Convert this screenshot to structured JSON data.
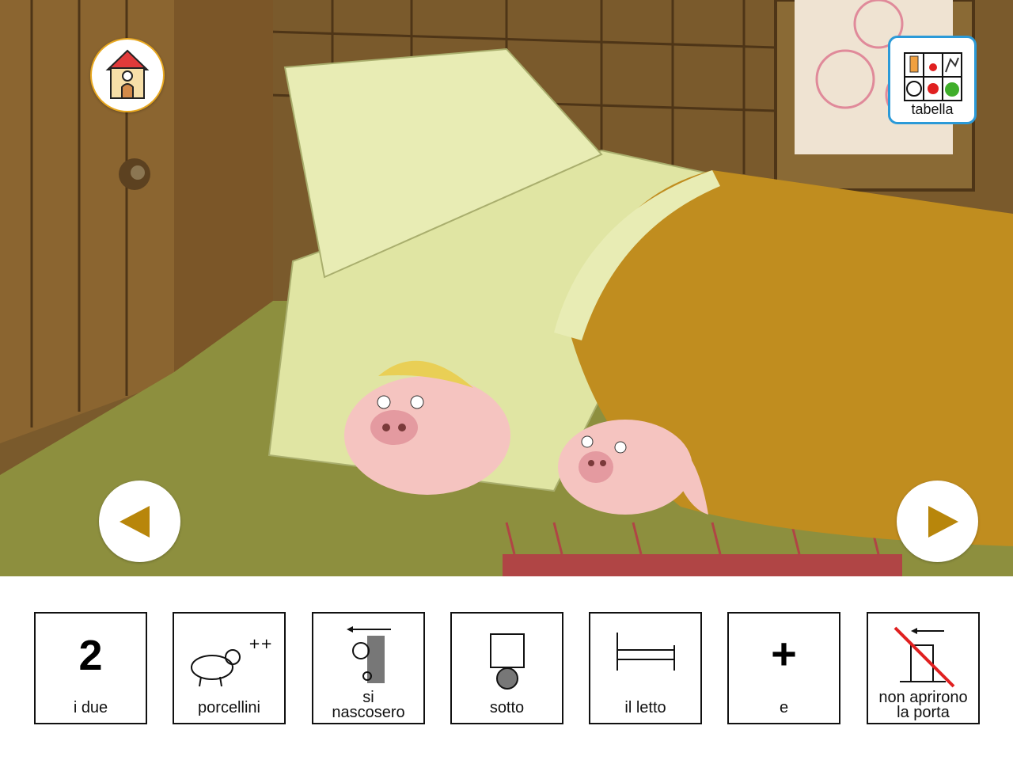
{
  "nav": {
    "home_icon": "house-icon",
    "prev_icon": "triangle-left-icon",
    "next_icon": "triangle-right-icon",
    "tabella_label": "tabella",
    "tabella_icon": "communication-board-icon"
  },
  "colors": {
    "accent_blue": "#2b9ad8",
    "arrow_gold": "#b8860b",
    "home_border": "#e8a820"
  },
  "sentence": [
    {
      "id": "i-due",
      "label": "i due",
      "symbol": "2",
      "icon": "number-two-icon"
    },
    {
      "id": "porcellini",
      "label": "porcellini",
      "icon": "pigs-plural-icon"
    },
    {
      "id": "si-nascosero",
      "label": "si\nnascosero",
      "icon": "hide-behind-wall-icon"
    },
    {
      "id": "sotto",
      "label": "sotto",
      "icon": "under-icon"
    },
    {
      "id": "il-letto",
      "label": "il letto",
      "icon": "bed-icon"
    },
    {
      "id": "e",
      "label": "e",
      "symbol": "+",
      "icon": "plus-icon"
    },
    {
      "id": "non-aprirono",
      "label": "non aprirono\nla porta",
      "icon": "do-not-open-door-icon"
    }
  ]
}
